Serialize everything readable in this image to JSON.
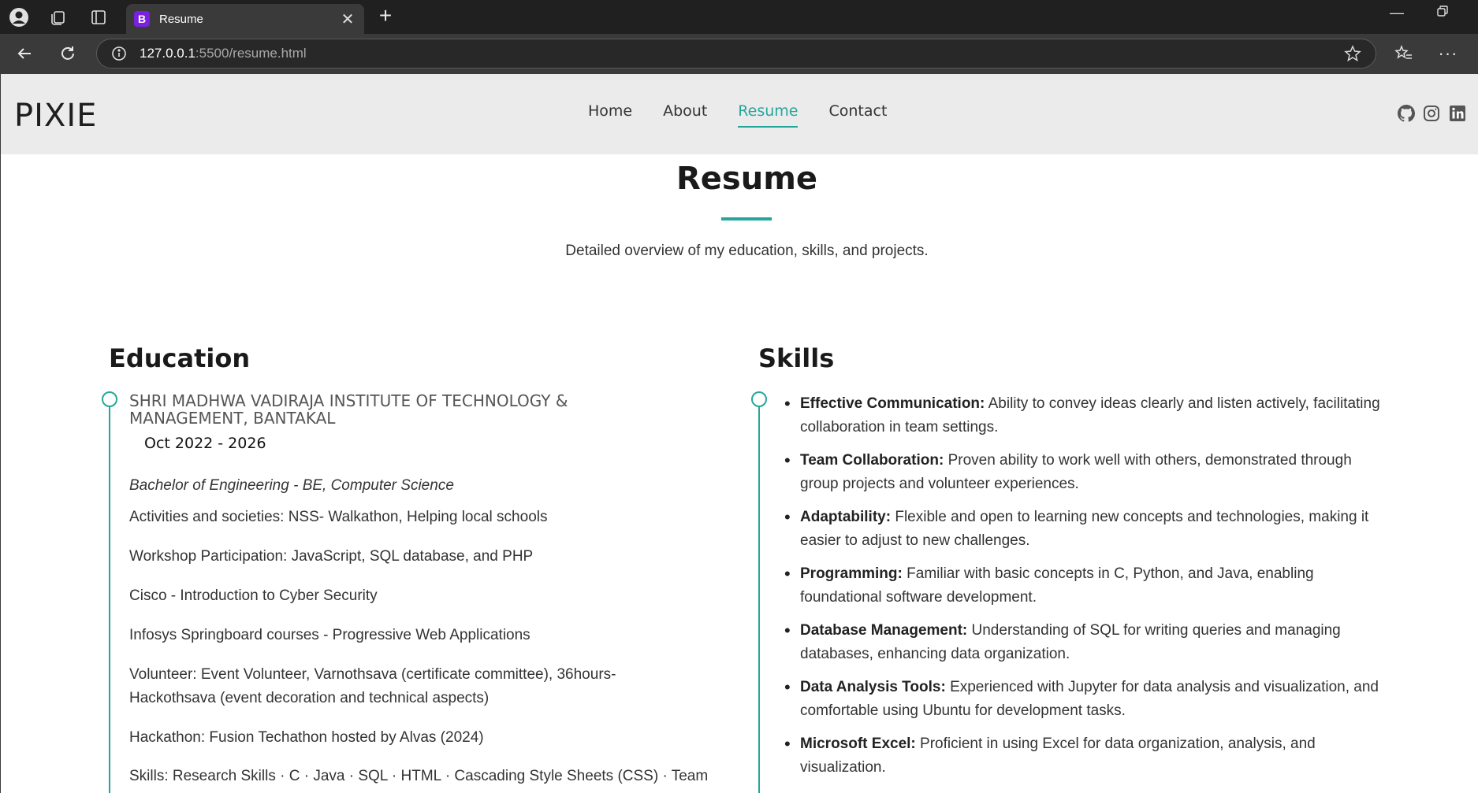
{
  "browser": {
    "tab_title": "Resume",
    "tab_favicon_letter": "B",
    "url_host": "127.0.0.1",
    "url_path": ":5500/resume.html",
    "icons": [
      "profile-icon",
      "collections-icon",
      "tab-actions-icon",
      "close-icon",
      "plus-icon",
      "back-icon",
      "refresh-icon",
      "info-icon",
      "star-icon",
      "favorites-icon",
      "more-icon"
    ]
  },
  "header": {
    "logo": "PIXIE",
    "nav": [
      {
        "label": "Home"
      },
      {
        "label": "About"
      },
      {
        "label": "Resume"
      },
      {
        "label": "Contact"
      }
    ],
    "active_nav": "Resume",
    "social_icons": [
      "github-icon",
      "instagram-icon",
      "linkedin-icon"
    ]
  },
  "page": {
    "title": "Resume",
    "subtitle": "Detailed overview of my education, skills, and projects."
  },
  "education": {
    "heading": "Education",
    "institution": "SHRI MADHWA VADIRAJA INSTITUTE OF TECHNOLOGY & MANAGEMENT, BANTAKAL",
    "date": "Oct 2022 - 2026",
    "degree": "Bachelor of Engineering - BE, Computer Science",
    "items": [
      "Activities and societies: NSS- Walkathon, Helping local schools",
      "Workshop Participation: JavaScript, SQL database, and PHP",
      "Cisco - Introduction to Cyber Security",
      "Infosys Springboard courses - Progressive Web Applications",
      "Volunteer: Event Volunteer, Varnothsava (certificate committee), 36hours-Hackothsava (event decoration and technical aspects)",
      "Hackathon: Fusion Techathon hosted by Alvas (2024)",
      "Skills: Research Skills · C · Java · SQL · HTML · Cascading Style Sheets (CSS) · Team"
    ]
  },
  "skills": {
    "heading": "Skills",
    "items": [
      {
        "name": "Effective Communication:",
        "desc": "Ability to convey ideas clearly and listen actively, facilitating collaboration in team settings."
      },
      {
        "name": "Team Collaboration:",
        "desc": "Proven ability to work well with others, demonstrated through group projects and volunteer experiences."
      },
      {
        "name": "Adaptability:",
        "desc": "Flexible and open to learning new concepts and technologies, making it easier to adjust to new challenges."
      },
      {
        "name": "Programming:",
        "desc": "Familiar with basic concepts in C, Python, and Java, enabling foundational software development."
      },
      {
        "name": "Database Management:",
        "desc": "Understanding of SQL for writing queries and managing databases, enhancing data organization."
      },
      {
        "name": "Data Analysis Tools:",
        "desc": "Experienced with Jupyter for data analysis and visualization, and comfortable using Ubuntu for development tasks."
      },
      {
        "name": "Microsoft Excel:",
        "desc": "Proficient in using Excel for data organization, analysis, and visualization."
      }
    ]
  },
  "colors": {
    "accent": "#26a69a",
    "header_bg": "#ebebeb",
    "chrome_dark": "#202020"
  }
}
